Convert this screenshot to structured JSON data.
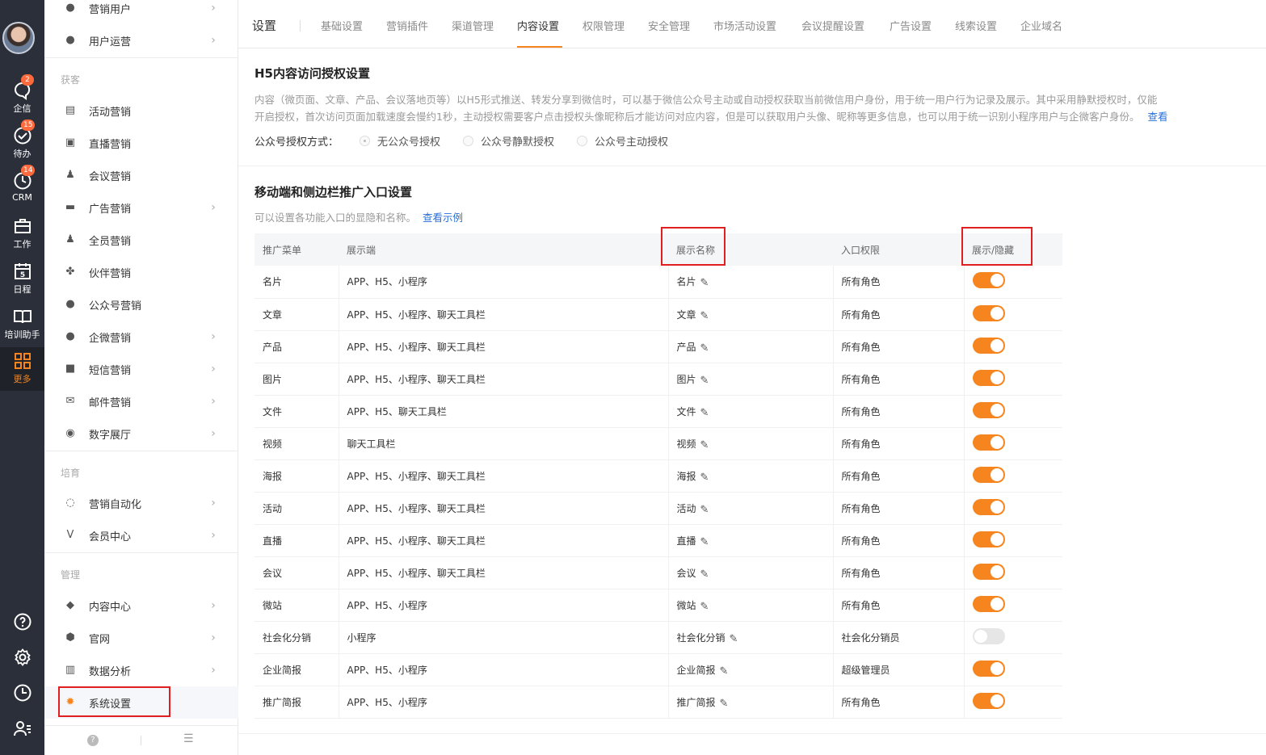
{
  "rail": {
    "items": [
      {
        "label": "企信",
        "icon": "chat-bubble-icon",
        "badge": "2"
      },
      {
        "label": "待办",
        "icon": "check-circle-icon",
        "badge": "15"
      },
      {
        "label": "CRM",
        "icon": "clock-icon",
        "badge": "14"
      },
      {
        "label": "工作",
        "icon": "briefcase-icon",
        "badge": ""
      },
      {
        "label": "日程",
        "icon": "calendar-icon",
        "badge": ""
      },
      {
        "label": "培训助手",
        "icon": "book-icon",
        "badge": ""
      },
      {
        "label": "更多",
        "icon": "grid-icon",
        "badge": ""
      }
    ],
    "calendar_day": "5"
  },
  "menu": {
    "items": [
      {
        "label": "营销用户",
        "icon": "user-icon"
      },
      {
        "label": "用户运营",
        "icon": "user-gear-icon"
      },
      {
        "label": "活动营销",
        "icon": "doc-icon"
      },
      {
        "label": "直播营销",
        "icon": "live-icon"
      },
      {
        "label": "会议营销",
        "icon": "people-icon"
      },
      {
        "label": "广告营销",
        "icon": "ad-icon"
      },
      {
        "label": "全员营销",
        "icon": "group-icon"
      },
      {
        "label": "伙伴营销",
        "icon": "partner-icon"
      },
      {
        "label": "公众号营销",
        "icon": "wechat-icon"
      },
      {
        "label": "企微营销",
        "icon": "wecom-icon"
      },
      {
        "label": "短信营销",
        "icon": "sms-icon"
      },
      {
        "label": "邮件营销",
        "icon": "mail-icon"
      },
      {
        "label": "数字展厅",
        "icon": "hall-icon"
      },
      {
        "label": "营销自动化",
        "icon": "automation-icon"
      },
      {
        "label": "会员中心",
        "icon": "vip-icon"
      },
      {
        "label": "内容中心",
        "icon": "layers-icon"
      },
      {
        "label": "官网",
        "icon": "website-icon"
      },
      {
        "label": "数据分析",
        "icon": "chart-icon"
      },
      {
        "label": "系统设置",
        "icon": "gear-icon"
      }
    ],
    "groups": [
      "获客",
      "培育",
      "管理"
    ]
  },
  "tabs": {
    "title": "设置",
    "items": [
      "基础设置",
      "营销插件",
      "渠道管理",
      "内容设置",
      "权限管理",
      "安全管理",
      "市场活动设置",
      "会议提醒设置",
      "广告设置",
      "线索设置",
      "企业域名"
    ],
    "active": "内容设置"
  },
  "h5": {
    "title": "H5内容访问授权设置",
    "desc_line1": "内容（微页面、文章、产品、会议落地页等）以H5形式推送、转发分享到微信时，可以基于微信公众号主动或自动授权获取当前微信用户身份，用于统一用户行为记录及展示。其中采用静默授权时，仅能",
    "desc_line2": "开启授权，首次访问页面加载速度会慢约1秒，主动授权需要客户点击授权头像昵称后才能访问对应内容，但是可以获取用户头像、昵称等更多信息，也可以用于统一识别小程序用户与企微客户身份。",
    "desc_link": "查看",
    "auth_label": "公众号授权方式：",
    "options": [
      "无公众号授权",
      "公众号静默授权",
      "公众号主动授权"
    ],
    "selected": "无公众号授权"
  },
  "entry": {
    "title": "移动端和侧边栏推广入口设置",
    "subtitle": "可以设置各功能入口的显隐和名称。",
    "link": "查看示例",
    "columns": [
      "推广菜单",
      "展示端",
      "展示名称",
      "入口权限",
      "展示/隐藏"
    ],
    "rows": [
      {
        "menu": "名片",
        "platform": "APP、H5、小程序",
        "name": "名片",
        "permission": "所有角色",
        "shown": true
      },
      {
        "menu": "文章",
        "platform": "APP、H5、小程序、聊天工具栏",
        "name": "文章",
        "permission": "所有角色",
        "shown": true
      },
      {
        "menu": "产品",
        "platform": "APP、H5、小程序、聊天工具栏",
        "name": "产品",
        "permission": "所有角色",
        "shown": true
      },
      {
        "menu": "图片",
        "platform": "APP、H5、小程序、聊天工具栏",
        "name": "图片",
        "permission": "所有角色",
        "shown": true
      },
      {
        "menu": "文件",
        "platform": "APP、H5、聊天工具栏",
        "name": "文件",
        "permission": "所有角色",
        "shown": true
      },
      {
        "menu": "视频",
        "platform": "聊天工具栏",
        "name": "视频",
        "permission": "所有角色",
        "shown": true
      },
      {
        "menu": "海报",
        "platform": "APP、H5、小程序、聊天工具栏",
        "name": "海报",
        "permission": "所有角色",
        "shown": true
      },
      {
        "menu": "活动",
        "platform": "APP、H5、小程序、聊天工具栏",
        "name": "活动",
        "permission": "所有角色",
        "shown": true
      },
      {
        "menu": "直播",
        "platform": "APP、H5、小程序、聊天工具栏",
        "name": "直播",
        "permission": "所有角色",
        "shown": true
      },
      {
        "menu": "会议",
        "platform": "APP、H5、小程序、聊天工具栏",
        "name": "会议",
        "permission": "所有角色",
        "shown": true
      },
      {
        "menu": "微站",
        "platform": "APP、H5、小程序",
        "name": "微站",
        "permission": "所有角色",
        "shown": true
      },
      {
        "menu": "社会化分销",
        "platform": "小程序",
        "name": "社会化分销",
        "permission": "社会化分销员",
        "shown": false
      },
      {
        "menu": "企业简报",
        "platform": "APP、H5、小程序",
        "name": "企业简报",
        "permission": "超级管理员",
        "shown": true
      },
      {
        "menu": "推广简报",
        "platform": "APP、H5、小程序",
        "name": "推广简报",
        "permission": "所有角色",
        "shown": true
      }
    ]
  },
  "colors": {
    "accent": "#f7851f",
    "rail": "#2b2f3a",
    "link": "#2a6fd6",
    "highlight_box": "#e02020"
  }
}
